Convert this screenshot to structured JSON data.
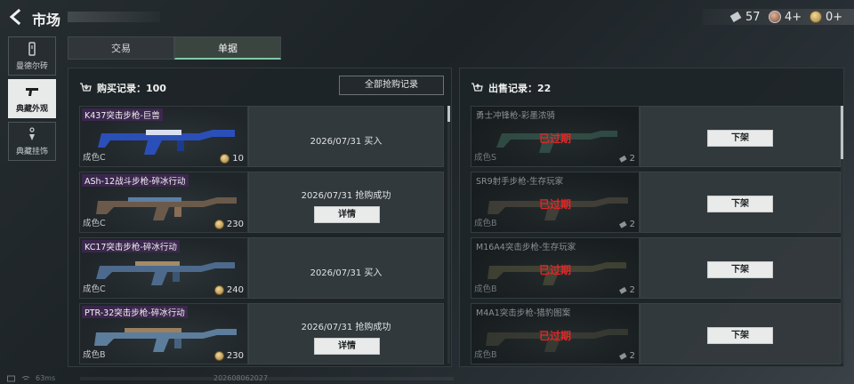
{
  "header": {
    "title": "市场"
  },
  "currencies": [
    {
      "name": "ticket-icon",
      "value": "57"
    },
    {
      "name": "badge-icon",
      "value": "4+"
    },
    {
      "name": "coin-icon",
      "value": "0+"
    }
  ],
  "sidebar": {
    "items": [
      {
        "label": "曼德尔砖",
        "icon": "brick-icon",
        "active": false
      },
      {
        "label": "典藏外观",
        "icon": "pistol-icon",
        "active": true
      },
      {
        "label": "典藏挂饰",
        "icon": "charm-icon",
        "active": false
      }
    ]
  },
  "tabs": [
    {
      "label": "交易",
      "active": false
    },
    {
      "label": "单据",
      "active": true
    }
  ],
  "purchase": {
    "header": "购买记录：100",
    "all_button": "全部抢购记录",
    "rows": [
      {
        "name": "K437突击步枪-巨兽",
        "grade": "成色C",
        "price": "10",
        "date": "2026/07/31 买入",
        "status": "",
        "has_detail": false
      },
      {
        "name": "ASh-12战斗步枪-碎冰行动",
        "grade": "成色C",
        "price": "230",
        "date": "2026/07/31 抢购成功",
        "status": "",
        "has_detail": true
      },
      {
        "name": "KC17突击步枪-碎冰行动",
        "grade": "成色C",
        "price": "240",
        "date": "2026/07/31 买入",
        "status": "",
        "has_detail": false
      },
      {
        "name": "PTR-32突击步枪-碎冰行动",
        "grade": "成色B",
        "price": "230",
        "date": "2026/07/31 抢购成功",
        "status": "",
        "has_detail": true
      }
    ],
    "detail_label": "详情"
  },
  "sales": {
    "header": "出售记录：22",
    "rows": [
      {
        "name": "勇士冲锋枪-彩墨浓骑",
        "grade": "成色S",
        "count": "2",
        "status": "已过期"
      },
      {
        "name": "SR9射手步枪-生存玩家",
        "grade": "成色B",
        "count": "2",
        "status": "已过期"
      },
      {
        "name": "M16A4突击步枪-生存玩家",
        "grade": "成色B",
        "count": "2",
        "status": "已过期"
      },
      {
        "name": "M4A1突击步枪-猎豹图案",
        "grade": "成色B",
        "count": "2",
        "status": "已过期"
      }
    ],
    "action_label": "下架"
  },
  "footer": {
    "ping": "63ms",
    "build": "202608062027"
  },
  "colors": {
    "accent": "#7fc9a8",
    "expired": "#e12626",
    "name_tag": "#46285a"
  }
}
